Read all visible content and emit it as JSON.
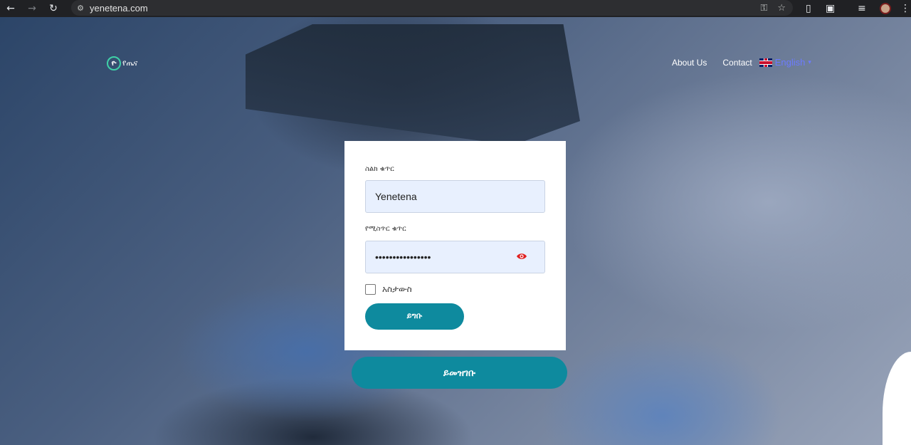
{
  "browser": {
    "url": "yenetena.com"
  },
  "header": {
    "logo_text": "የጤና",
    "nav": [
      {
        "label": "About Us"
      },
      {
        "label": "Contact"
      }
    ],
    "language": "English"
  },
  "login": {
    "username_label": "ስልክ ቁጥር",
    "username_value": "Yenetena",
    "password_label": "የሚስጥር ቁጥር",
    "password_value": "••••••••••••••••",
    "remember_label": "አስታውስ",
    "login_button": "ይግቡ",
    "register_button": "ይመዝገቡ"
  },
  "colors": {
    "primary": "#0e8a9e",
    "input_bg": "#e8f0fe",
    "lang_link": "#6c7bff",
    "eye_icon": "#e02020"
  }
}
